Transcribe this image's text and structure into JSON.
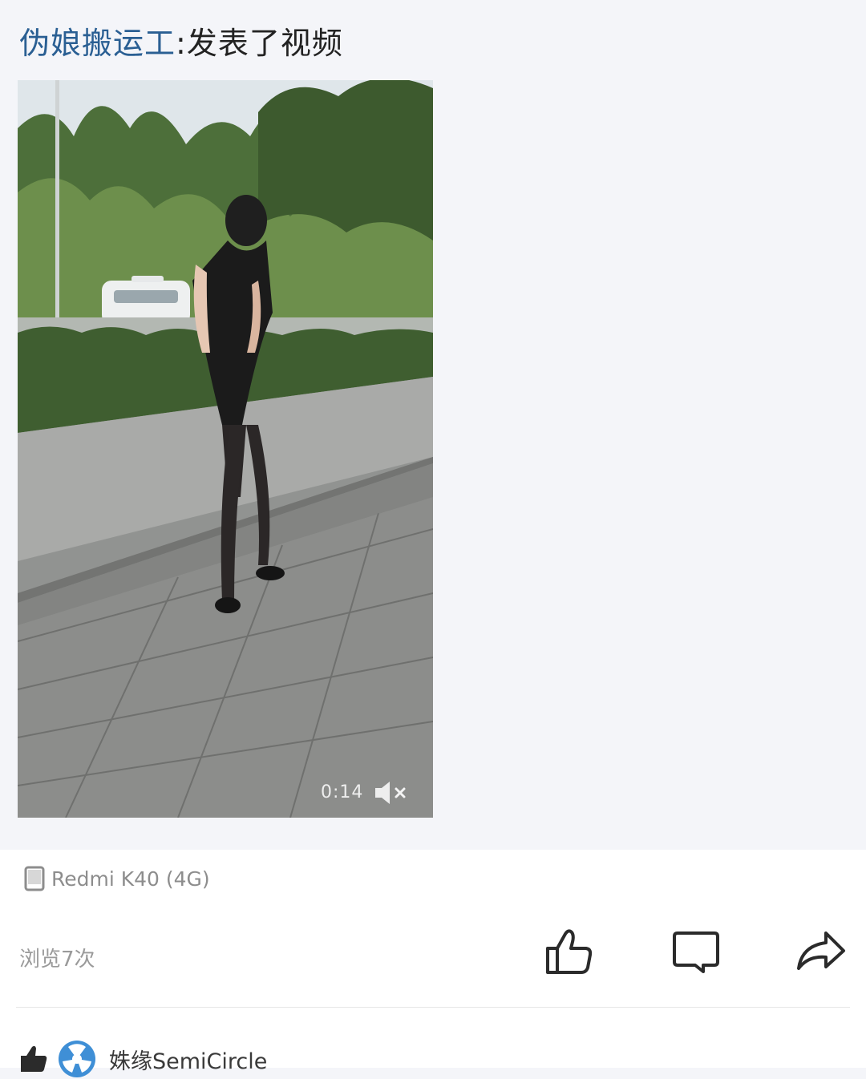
{
  "post": {
    "author": "伪娘搬运工",
    "separator": ":",
    "action": "发表了视频"
  },
  "video": {
    "duration": "0:14",
    "mute_icon": "speaker-muted-icon"
  },
  "meta": {
    "device": "Redmi K40 (4G)",
    "views": "浏览7次"
  },
  "actions": [
    {
      "name": "like-button",
      "icon": "thumbs-up-icon"
    },
    {
      "name": "comment-button",
      "icon": "comment-bubble-icon"
    },
    {
      "name": "share-button",
      "icon": "share-arrow-icon"
    }
  ],
  "likers": {
    "first_name": "姝缘SemiCircle"
  },
  "colors": {
    "author": "#2a5f93",
    "page_bg": "#f4f5f9",
    "icon": "#2b2b2b",
    "muted_text": "#9a9a9a",
    "avatar": "#3f8fd6"
  }
}
